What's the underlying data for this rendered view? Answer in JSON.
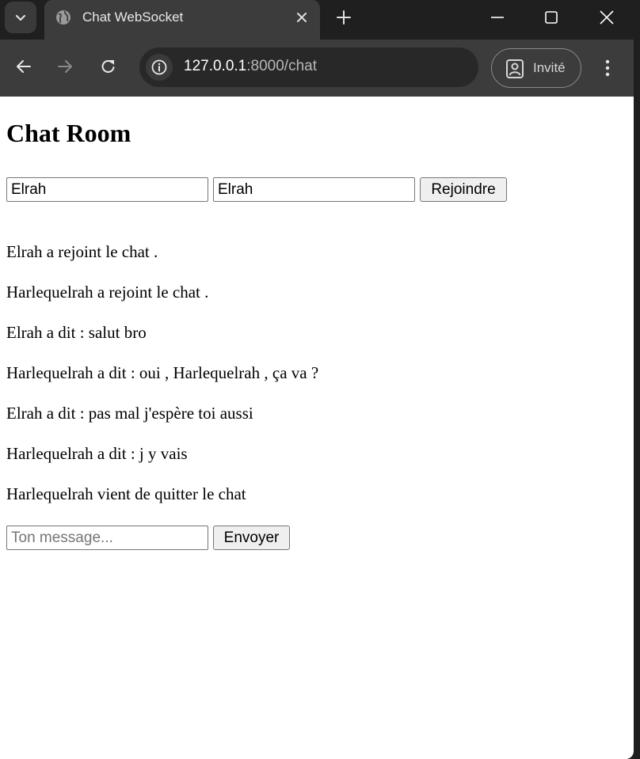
{
  "browser": {
    "tab": {
      "title": "Chat WebSocket",
      "favicon": "globe-icon"
    },
    "url": {
      "host": "127.0.0.1",
      "rest": ":8000/chat"
    },
    "profile_label": "Invité"
  },
  "page": {
    "title": "Chat Room",
    "join": {
      "name_value": "Elrah",
      "room_value": "Elrah",
      "join_label": "Rejoindre"
    },
    "messages": [
      "Elrah a rejoint le chat .",
      "Harlequelrah a rejoint le chat .",
      "Elrah a dit : salut bro",
      "Harlequelrah a dit : oui , Harlequelrah , ça va ?",
      "Elrah a dit : pas mal j'espère toi aussi",
      "Harlequelrah a dit : j y vais",
      "Harlequelrah vient de quitter le chat"
    ],
    "composer": {
      "placeholder": "Ton message...",
      "value": "",
      "send_label": "Envoyer"
    }
  }
}
